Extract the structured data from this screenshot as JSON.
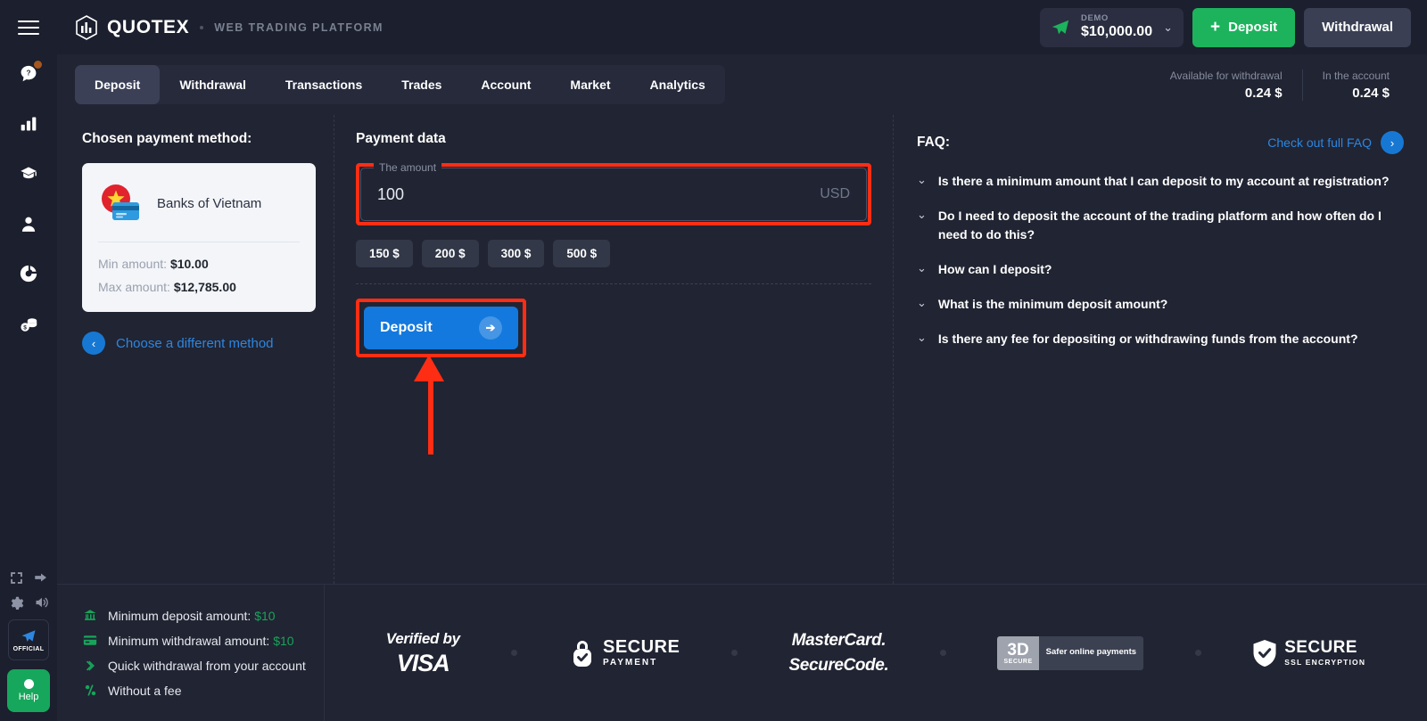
{
  "brand": {
    "name": "QUOTEX",
    "subtitle": "WEB TRADING PLATFORM"
  },
  "header": {
    "balance": {
      "kind": "DEMO",
      "amount": "$10,000.00"
    },
    "deposit_button": "Deposit",
    "withdrawal_button": "Withdrawal",
    "plus": "+",
    "chevron": "⌄"
  },
  "tabs": [
    {
      "label": "Deposit",
      "active": true
    },
    {
      "label": "Withdrawal",
      "active": false
    },
    {
      "label": "Transactions",
      "active": false
    },
    {
      "label": "Trades",
      "active": false
    },
    {
      "label": "Account",
      "active": false
    },
    {
      "label": "Market",
      "active": false
    },
    {
      "label": "Analytics",
      "active": false
    }
  ],
  "account_summary": [
    {
      "label": "Available for withdrawal",
      "value": "0.24 $"
    },
    {
      "label": "In the account",
      "value": "0.24 $"
    }
  ],
  "chosen_method": {
    "title": "Chosen payment method:",
    "name": "Banks of Vietnam",
    "min_label": "Min amount:",
    "min_value": "$10.00",
    "max_label": "Max amount:",
    "max_value": "$12,785.00",
    "change_link": "Choose a different method",
    "back_chevron": "‹"
  },
  "payment_data": {
    "title": "Payment data",
    "amount_legend": "The amount",
    "amount_value": "100",
    "currency": "USD",
    "quick_amounts": [
      "150 $",
      "200 $",
      "300 $",
      "500 $"
    ],
    "deposit_button": "Deposit",
    "deposit_arrow": "➔"
  },
  "faq": {
    "title": "FAQ:",
    "link": "Check out full FAQ",
    "link_arrow": "›",
    "chevron": "⌄",
    "questions": [
      "Is there a minimum amount that I can deposit to my account at registration?",
      "Do I need to deposit the account of the trading platform and how often do I need to do this?",
      "How can I deposit?",
      "What is the minimum deposit amount?",
      "Is there any fee for depositing or withdrawing funds from the account?"
    ]
  },
  "footer": {
    "benefits": [
      {
        "icon": "bank-icon",
        "text": "Minimum deposit amount:",
        "value": "$10"
      },
      {
        "icon": "card-icon",
        "text": "Minimum withdrawal amount:",
        "value": "$10"
      },
      {
        "icon": "double-chevron-icon",
        "text": "Quick withdrawal from your account",
        "value": ""
      },
      {
        "icon": "percent-icon",
        "text": "Without a fee",
        "value": ""
      }
    ],
    "badges": {
      "visa_l1": "Verified by",
      "visa_l2": "VISA",
      "secure_l1": "SECURE",
      "secure_l2": "PAYMENT",
      "mastercard_l1": "MasterCard.",
      "mastercard_l2": "SecureCode.",
      "tds_big": "3D",
      "tds_small": "SECURE",
      "tds_text": "Safer online payments",
      "ssl_l1": "SECURE",
      "ssl_l2": "SSL ENCRYPTION"
    }
  },
  "rail": {
    "official_label": "OFFICIAL",
    "help_label": "Help"
  },
  "colors": {
    "background": "#212432",
    "panel": "#1C1F2D",
    "accent_blue": "#1379DE",
    "accent_green": "#1CB35C",
    "highlight_red": "#FF2D13",
    "link_blue": "#2D86E0"
  }
}
